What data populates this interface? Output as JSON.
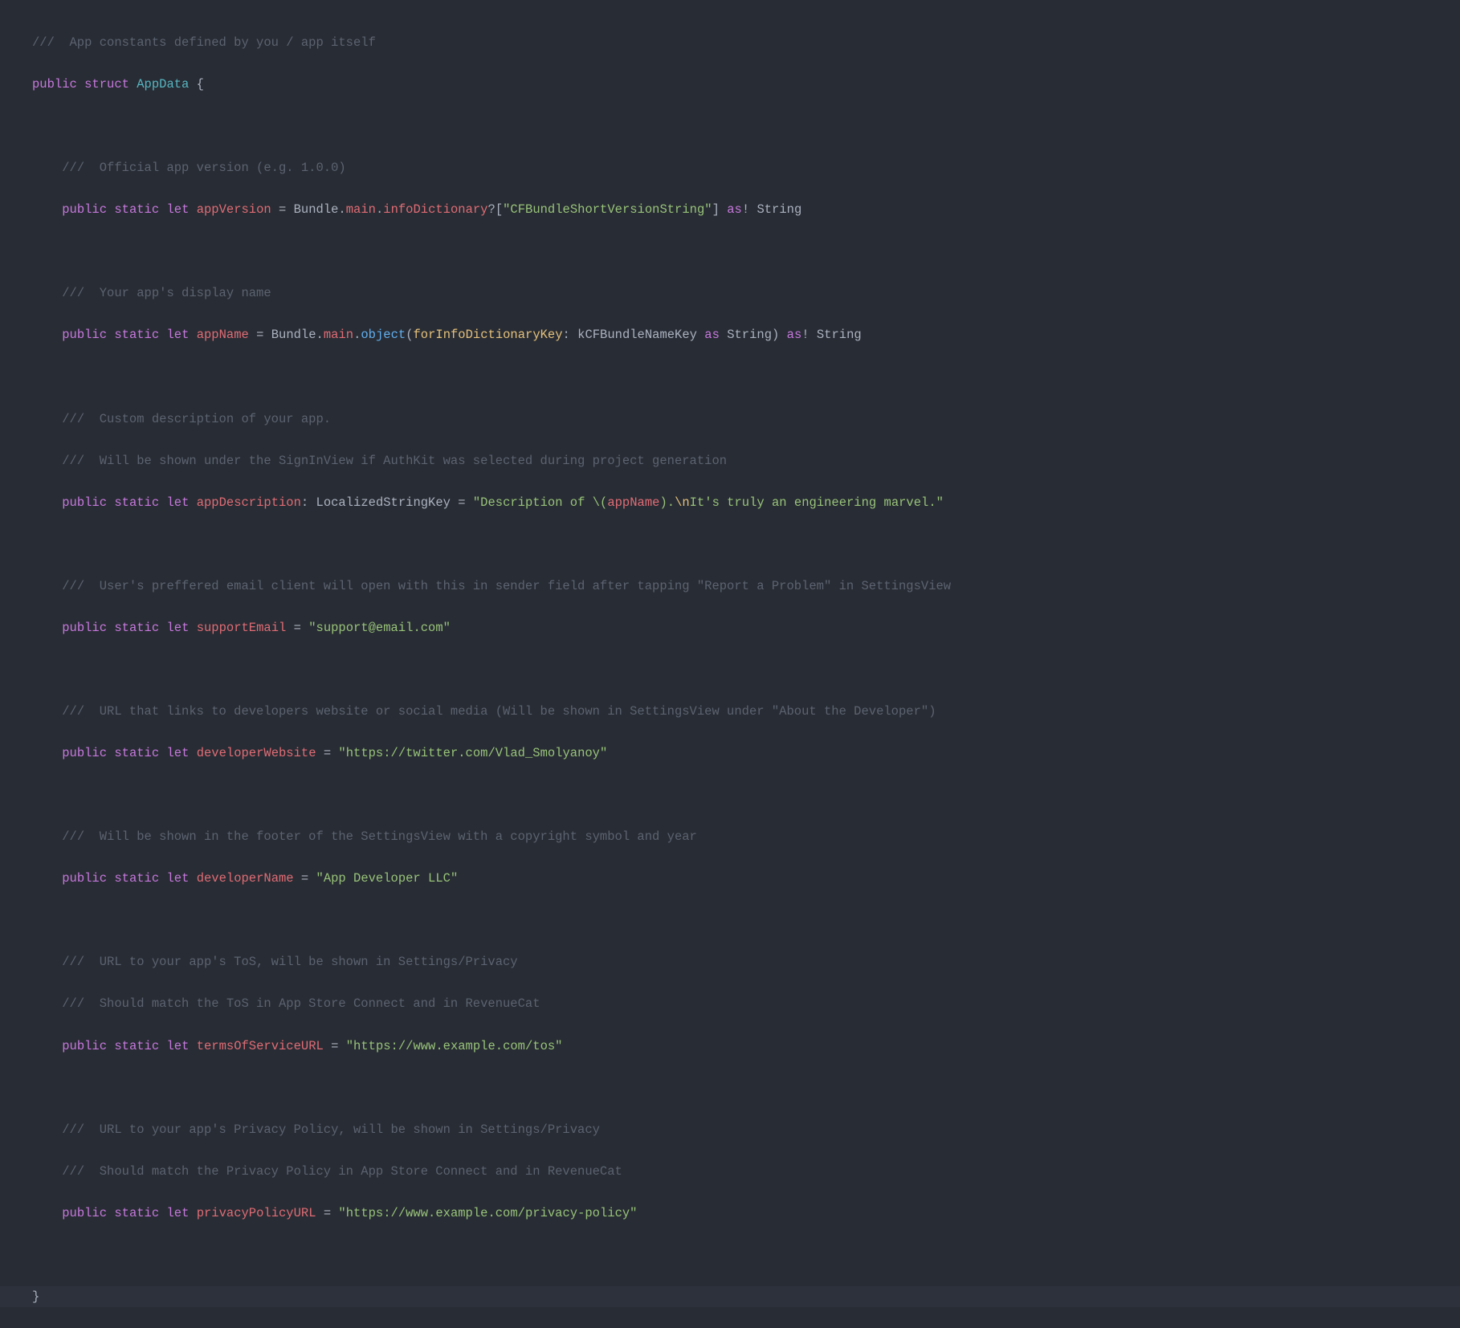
{
  "code": {
    "comment_top": "///  App constants defined by you / app itself",
    "kw_public": "public",
    "kw_struct": "struct",
    "kw_static": "static",
    "kw_let": "let",
    "kw_as": "as",
    "type_AppData": "AppData",
    "brace_open": " {",
    "brace_close": "}",
    "c_appVersion": "///  Official app version (e.g. 1.0.0)",
    "id_appVersion": "appVersion",
    "eq": " = ",
    "tok_Bundle": "Bundle",
    "tok_main": "main",
    "tok_infoDictionary": "infoDictionary",
    "q_mark": "?",
    "bracket_open": "[",
    "str_CFBundleShortVersionString": "\"CFBundleShortVersionString\"",
    "bracket_close": "]",
    "bang": "!",
    "type_String": "String",
    "c_appName": "///  Your app's display name",
    "id_appName": "appName",
    "tok_object": "object",
    "paren_open": "(",
    "param_forInfoDictionaryKey": "forInfoDictionaryKey",
    "colon_sp": ": ",
    "tok_kCFBundleNameKey": "kCFBundleNameKey",
    "paren_close": ")",
    "c_appDescription1": "///  Custom description of your app.",
    "c_appDescription2": "///  Will be shown under the SignInView if AuthKit was selected during project generation",
    "id_appDescription": "appDescription",
    "type_LocalizedStringKey": "LocalizedStringKey",
    "str_desc_a": "\"Description of ",
    "interp_open": "\\(",
    "interp_id": "appName",
    "interp_close": ")",
    "str_desc_b": ".",
    "esc_n": "\\n",
    "str_desc_c": "It's truly an engineering marvel.\"",
    "c_supportEmail": "///  User's preffered email client will open with this in sender field after tapping \"Report a Problem\" in SettingsView",
    "id_supportEmail": "supportEmail",
    "str_supportEmail": "\"support@email.com\"",
    "c_devWebsite": "///  URL that links to developers website or social media (Will be shown in SettingsView under \"About the Developer\")",
    "id_developerWebsite": "developerWebsite",
    "str_developerWebsite": "\"https://twitter.com/Vlad_Smolyanoy\"",
    "c_devName": "///  Will be shown in the footer of the SettingsView with a copyright symbol and year",
    "id_developerName": "developerName",
    "str_developerName": "\"App Developer LLC\"",
    "c_tos1": "///  URL to your app's ToS, will be shown in Settings/Privacy",
    "c_tos2": "///  Should match the ToS in App Store Connect and in RevenueCat",
    "id_termsOfServiceURL": "termsOfServiceURL",
    "str_termsOfServiceURL": "\"https://www.example.com/tos\"",
    "c_pp1": "///  URL to your app's Privacy Policy, will be shown in Settings/Privacy",
    "c_pp2": "///  Should match the Privacy Policy in App Store Connect and in RevenueCat",
    "id_privacyPolicyURL": "privacyPolicyURL",
    "str_privacyPolicyURL": "\"https://www.example.com/privacy-policy\"",
    "dot": "."
  }
}
